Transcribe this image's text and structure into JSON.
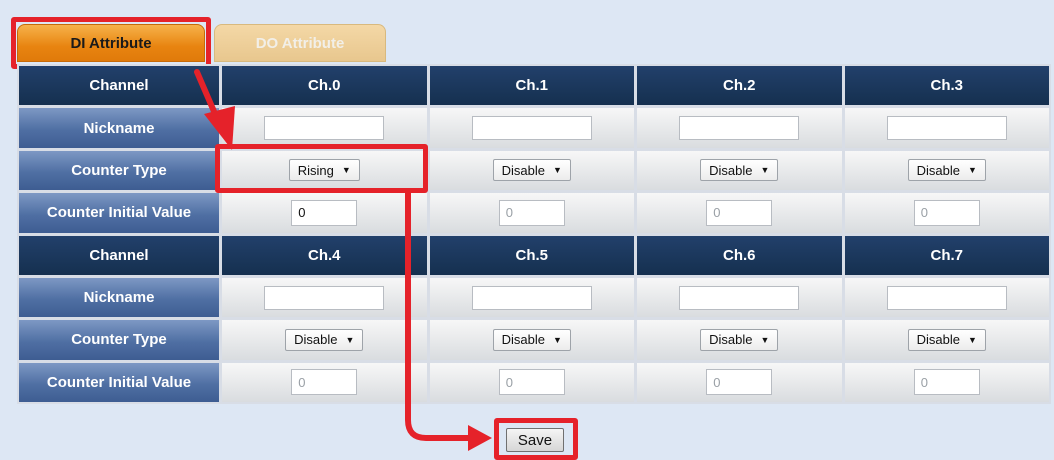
{
  "tabs": [
    {
      "label": "DI Attribute",
      "active": true
    },
    {
      "label": "DO Attribute",
      "active": false
    }
  ],
  "row_labels": {
    "channel": "Channel",
    "nickname": "Nickname",
    "counter_type": "Counter Type",
    "counter_initial_value": "Counter Initial Value"
  },
  "channels_top": [
    {
      "name": "Ch.0",
      "nickname": "",
      "counter_type": "Rising",
      "initial_value": "0"
    },
    {
      "name": "Ch.1",
      "nickname": "",
      "counter_type": "Disable",
      "initial_value": "0"
    },
    {
      "name": "Ch.2",
      "nickname": "",
      "counter_type": "Disable",
      "initial_value": "0"
    },
    {
      "name": "Ch.3",
      "nickname": "",
      "counter_type": "Disable",
      "initial_value": "0"
    }
  ],
  "channels_bottom": [
    {
      "name": "Ch.4",
      "nickname": "",
      "counter_type": "Disable",
      "initial_value": "0"
    },
    {
      "name": "Ch.5",
      "nickname": "",
      "counter_type": "Disable",
      "initial_value": "0"
    },
    {
      "name": "Ch.6",
      "nickname": "",
      "counter_type": "Disable",
      "initial_value": "0"
    },
    {
      "name": "Ch.7",
      "nickname": "",
      "counter_type": "Disable",
      "initial_value": "0"
    }
  ],
  "save_label": "Save",
  "colors": {
    "highlight": "#e5222a",
    "header": "#1f3a63",
    "label": "#5374a8",
    "active_tab": "#e88410"
  }
}
